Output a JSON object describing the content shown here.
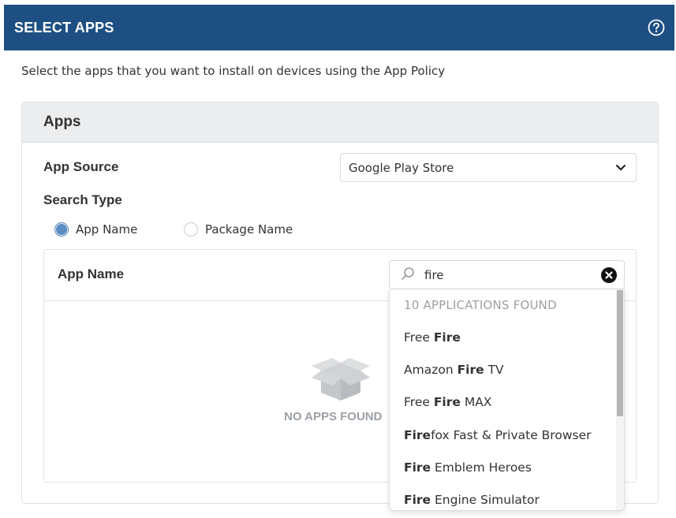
{
  "header": {
    "title": "SELECT APPS",
    "help_icon": "help-circle-icon"
  },
  "description": "Select the apps that you want to install on devices using the App Policy",
  "panel": {
    "title": "Apps",
    "app_source": {
      "label": "App Source",
      "selected": "Google Play Store"
    },
    "search_type": {
      "label": "Search Type",
      "options": [
        {
          "label": "App Name",
          "checked": true
        },
        {
          "label": "Package Name",
          "checked": false
        }
      ]
    },
    "app_name_label": "App Name",
    "empty_state": "NO APPS FOUND"
  },
  "search": {
    "value": "fire",
    "icon": "search-icon",
    "clear_icon": "clear-icon"
  },
  "dropdown": {
    "count_text": "10 APPLICATIONS FOUND",
    "items": [
      {
        "pre": "Free ",
        "match": "Fire",
        "post": ""
      },
      {
        "pre": "Amazon ",
        "match": "Fire",
        "post": " TV"
      },
      {
        "pre": "Free ",
        "match": "Fire",
        "post": " MAX"
      },
      {
        "pre": "",
        "match": "Fire",
        "post": "fox Fast & Private Browser"
      },
      {
        "pre": "",
        "match": "Fire",
        "post": " Emblem Heroes"
      },
      {
        "pre": "",
        "match": "Fire",
        "post": " Engine Simulator"
      }
    ]
  },
  "colors": {
    "header_bg": "#1d4f82",
    "panel_head_bg": "#ebedef",
    "radio_checked": "#5b8dc4"
  }
}
